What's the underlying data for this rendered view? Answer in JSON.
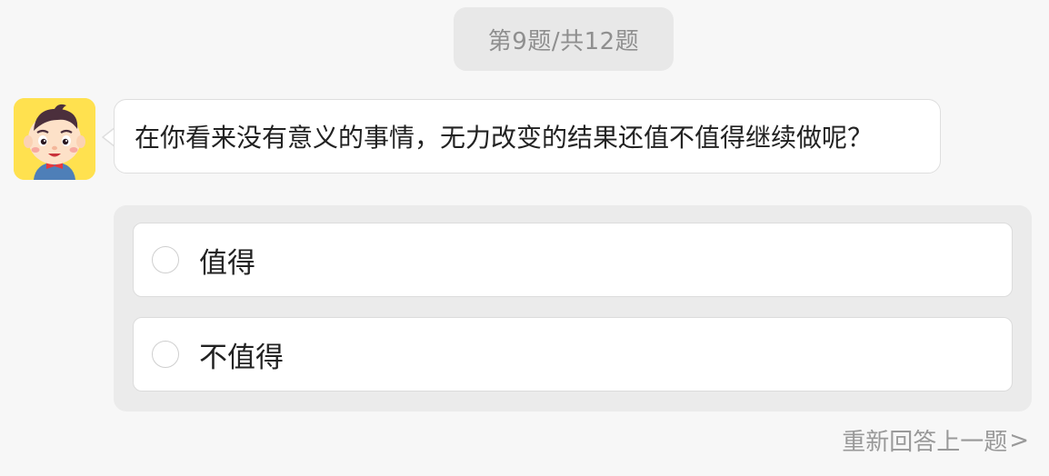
{
  "progress": {
    "label": "第9题/共12题"
  },
  "avatar": {
    "icon": "cartoon-boy-avatar-icon",
    "background_color": "#ffe14f"
  },
  "question": {
    "text": "在你看来没有意义的事情，无力改变的结果还值不值得继续做呢？"
  },
  "options": [
    {
      "label": "值得",
      "selected": false
    },
    {
      "label": "不值得",
      "selected": false
    }
  ],
  "footer": {
    "redo_label": "重新回答上一题",
    "redo_arrow": ">"
  },
  "colors": {
    "page_background": "#f7f7f7",
    "panel_background": "#ebebeb",
    "muted_text": "#999999"
  }
}
